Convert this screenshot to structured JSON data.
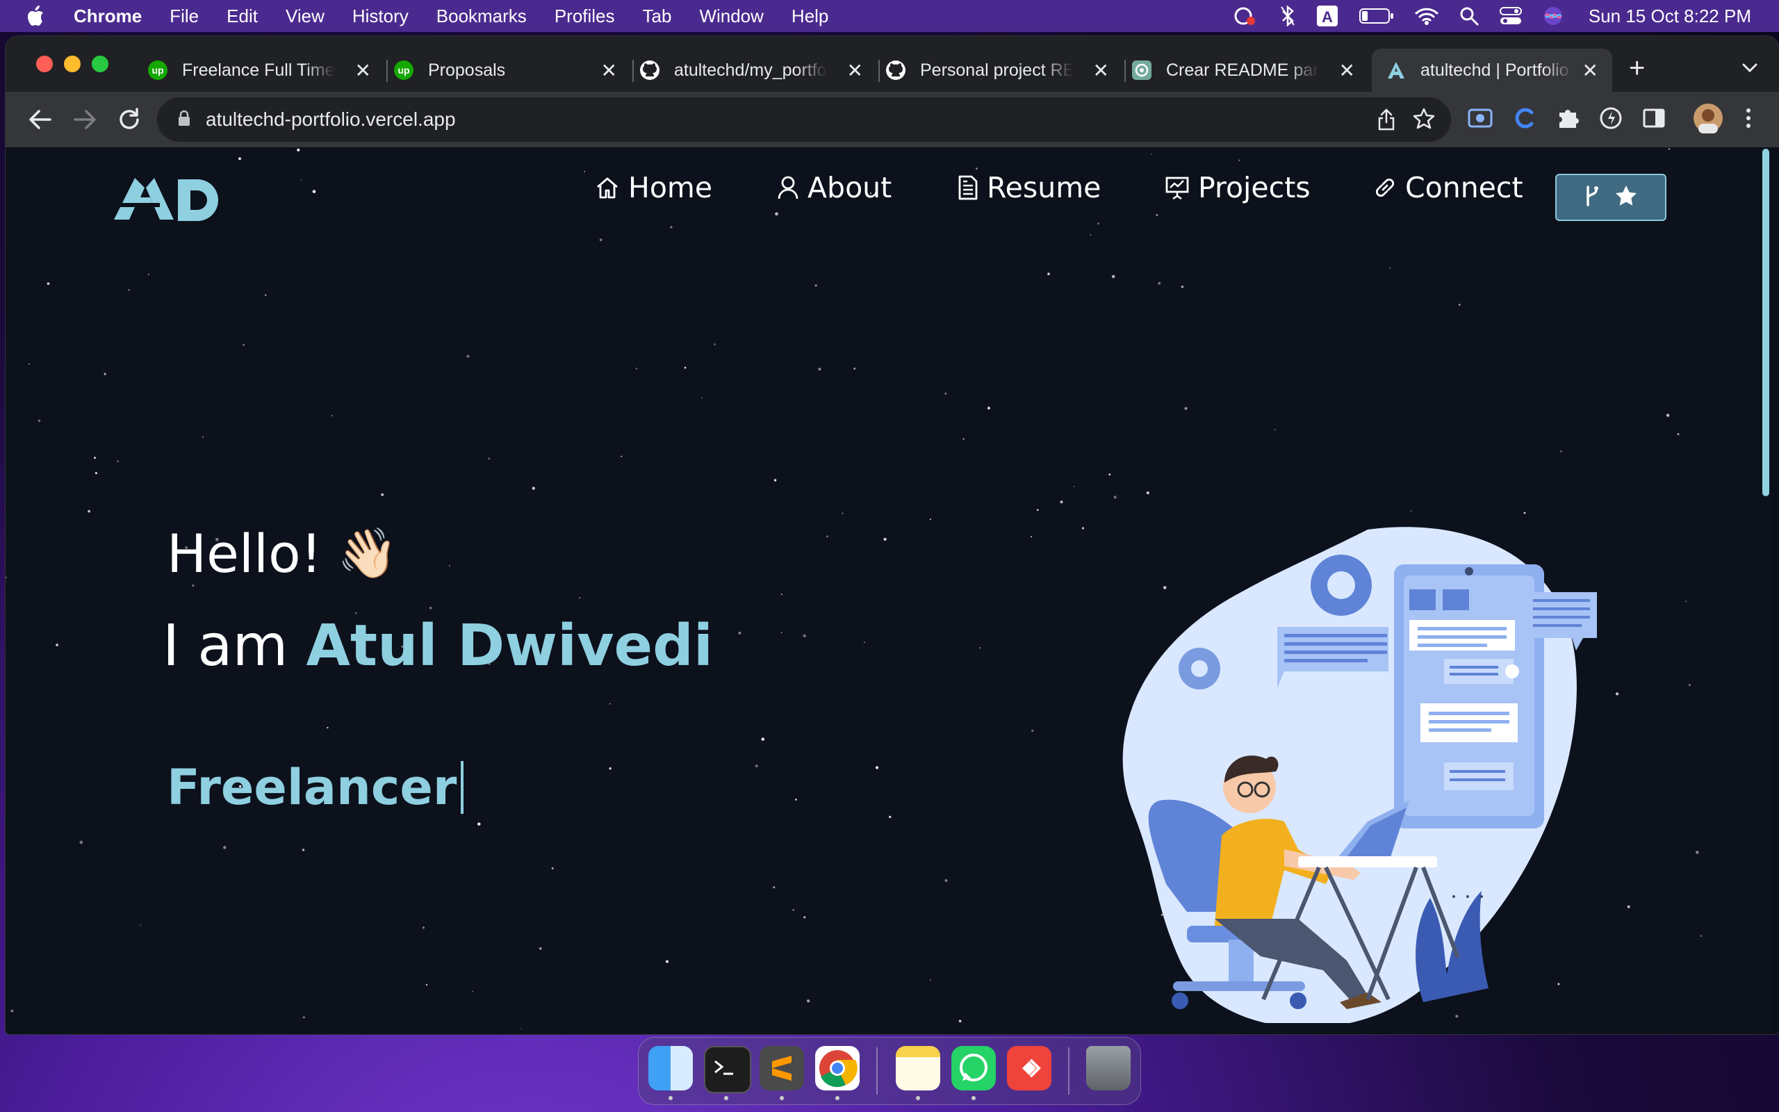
{
  "menubar": {
    "app": "Chrome",
    "items": [
      "File",
      "Edit",
      "View",
      "History",
      "Bookmarks",
      "Profiles",
      "Tab",
      "Window",
      "Help"
    ],
    "clock": "Sun 15 Oct  8:22 PM"
  },
  "tabs": [
    {
      "title": "Freelance Full Time",
      "icon": "upwork-icon"
    },
    {
      "title": "Proposals",
      "icon": "upwork-icon"
    },
    {
      "title": "atultechd/my_portfolio",
      "icon": "github-icon"
    },
    {
      "title": "Personal project README",
      "icon": "github-icon"
    },
    {
      "title": "Crear README para",
      "icon": "chatgpt-icon"
    },
    {
      "title": "atultechd | Portfolio",
      "icon": "portfolio-a-icon",
      "active": true
    }
  ],
  "toolbar": {
    "url": "atultechd-portfolio.vercel.app"
  },
  "site": {
    "logo": "AD",
    "nav": [
      {
        "label": "Home",
        "icon": "home-icon"
      },
      {
        "label": "About",
        "icon": "user-icon"
      },
      {
        "label": "Resume",
        "icon": "document-icon"
      },
      {
        "label": "Projects",
        "icon": "presentation-icon"
      },
      {
        "label": "Connect",
        "icon": "link-icon"
      }
    ],
    "github_button_icons": [
      "git-fork-icon",
      "star-icon"
    ]
  },
  "hero": {
    "greeting": "Hello!",
    "wave": "👋🏻",
    "intro": "I am ",
    "name": "Atul Dwivedi",
    "typed": "Freelancer"
  },
  "dock": {
    "apps": [
      "finder-icon",
      "terminal-icon",
      "sublime-text-icon",
      "chrome-icon",
      "notes-icon",
      "whatsapp-icon",
      "anydesk-icon",
      "trash-icon"
    ]
  },
  "colors": {
    "accent": "#8ecfe0",
    "page_bg": "#0c111c",
    "menubar": "#4b2a8f"
  }
}
